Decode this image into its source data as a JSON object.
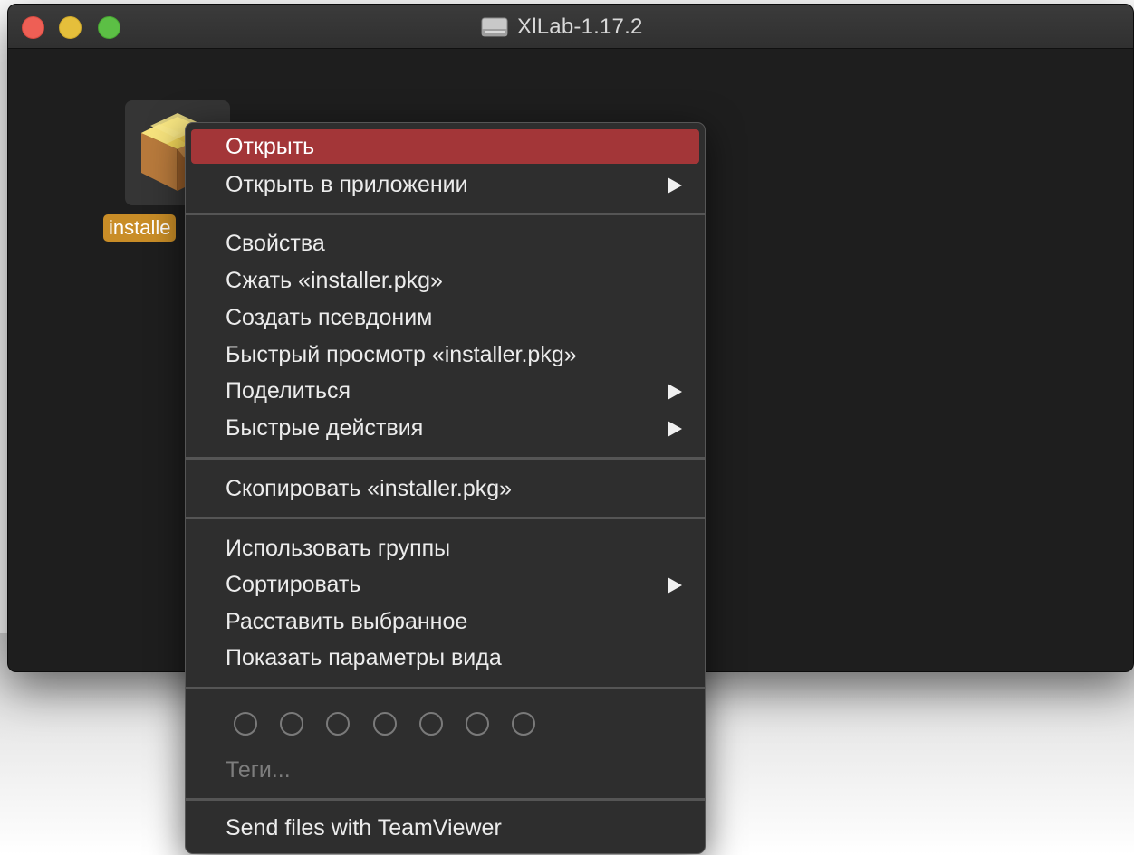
{
  "window": {
    "title": "XlLab-1.17.2",
    "controls": [
      "close",
      "minimize",
      "maximize"
    ],
    "title_icon": "disk-image-icon"
  },
  "file": {
    "name": "installer.pkg",
    "label_visible": "installe",
    "icon": "package-box-icon"
  },
  "menu": {
    "items": [
      {
        "label": "Открыть",
        "highlighted": true
      },
      {
        "label": "Открыть в приложении",
        "submenu": true
      },
      {
        "label": "Свойства"
      },
      {
        "label": "Сжать «installer.pkg»"
      },
      {
        "label": "Создать псевдоним"
      },
      {
        "label": "Быстрый просмотр «installer.pkg»"
      },
      {
        "label": "Поделиться",
        "submenu": true
      },
      {
        "label": "Быстрые действия",
        "submenu": true
      },
      {
        "label": "Скопировать «installer.pkg»"
      },
      {
        "label": "Использовать группы"
      },
      {
        "label": "Сортировать",
        "submenu": true
      },
      {
        "label": "Расставить выбранное"
      },
      {
        "label": "Показать параметры вида"
      },
      {
        "label": "Send files with TeamViewer"
      }
    ],
    "tags_label": "Теги...",
    "tag_color_count": 7
  },
  "colors": {
    "highlight": "#a33638",
    "file_label_bg": "#c98d27",
    "close": "#ee5f55",
    "minimize": "#e5bf3b",
    "maximize": "#5cbf45"
  }
}
